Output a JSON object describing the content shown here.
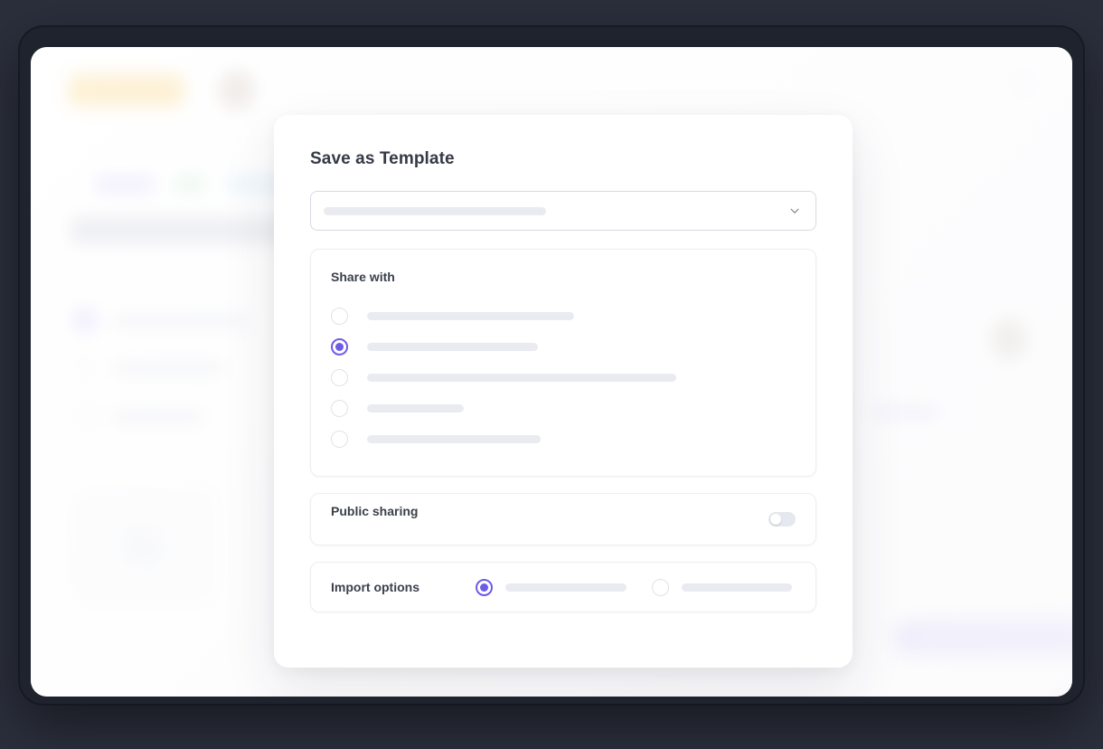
{
  "backdrop": {
    "color": "#2b2f3c",
    "frame_color": "#1f232e"
  },
  "theme": {
    "accent": "#6c5ce7",
    "skeleton": "#e9ebf0",
    "text_primary": "#353a45",
    "card_border": "#eceef2",
    "toggle_track": "#e5e8ee"
  },
  "modal": {
    "title": "Save as Template",
    "template_select": {
      "icon": "chevron-down-icon",
      "value": "",
      "placeholder": "",
      "skeleton_width": 246
    },
    "share_section": {
      "label": "Share with",
      "options": [
        {
          "selected": false,
          "skeleton_width": 229
        },
        {
          "selected": true,
          "skeleton_width": 189
        },
        {
          "selected": false,
          "skeleton_width": 342
        },
        {
          "selected": false,
          "skeleton_width": 107
        },
        {
          "selected": false,
          "skeleton_width": 192
        }
      ]
    },
    "public_sharing": {
      "label": "Public sharing",
      "toggle_on": false
    },
    "import_options": {
      "label": "Import options",
      "options": [
        {
          "selected": true,
          "skeleton_width": 134
        },
        {
          "selected": false,
          "skeleton_width": 122
        }
      ]
    }
  }
}
